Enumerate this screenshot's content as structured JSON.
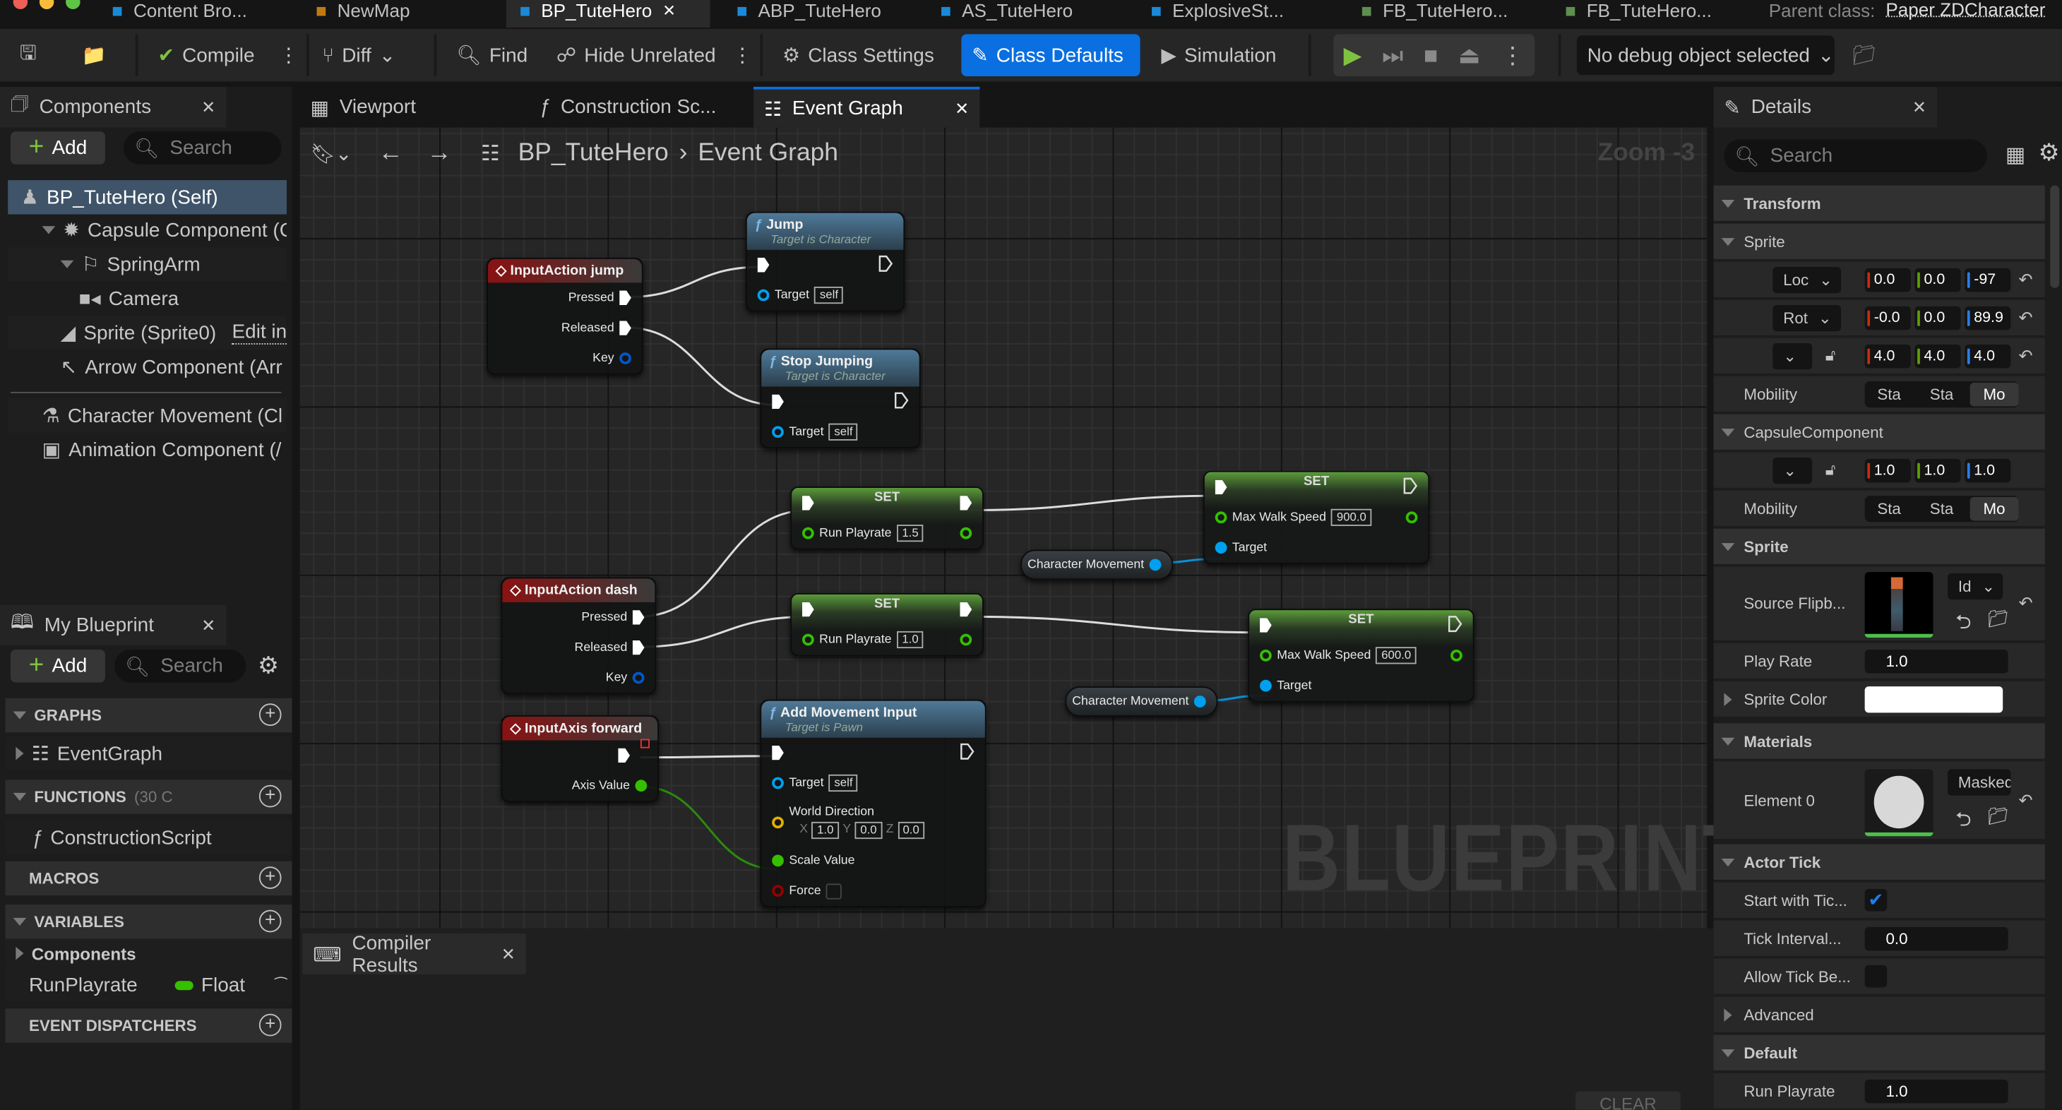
{
  "window_tabs": [
    {
      "label": "Content Bro...",
      "icon": "content-browser-icon"
    },
    {
      "label": "NewMap",
      "icon": "level-icon"
    },
    {
      "label": "BP_TuteHero",
      "icon": "blueprint-icon",
      "active": true,
      "closable": true
    },
    {
      "label": "ABP_TuteHero",
      "icon": "anim-blueprint-icon"
    },
    {
      "label": "AS_TuteHero",
      "icon": "anim-sequence-icon"
    },
    {
      "label": "ExplosiveSt...",
      "icon": "niagara-icon"
    },
    {
      "label": "FB_TuteHero...",
      "icon": "flipbook-icon"
    },
    {
      "label": "FB_TuteHero...",
      "icon": "flipbook-icon"
    }
  ],
  "parent_class": {
    "label": "Parent class:",
    "value": "Paper ZDCharacter"
  },
  "toolbar": {
    "compile": "Compile",
    "diff": "Diff",
    "find": "Find",
    "hide_unrelated": "Hide Unrelated",
    "class_settings": "Class Settings",
    "class_defaults": "Class Defaults",
    "simulation": "Simulation",
    "debug_object": "No debug object selected",
    "accent": "#0a6fe0",
    "play_color": "#7fc241"
  },
  "panel_tabs": {
    "components": "Components",
    "viewport": "Viewport",
    "construction": "Construction Sc...",
    "event_graph": "Event Graph",
    "details": "Details",
    "my_blueprint": "My Blueprint",
    "compiler_results": "Compiler Results"
  },
  "components": {
    "add": "Add",
    "search_placeholder": "Search",
    "items": [
      {
        "label": "BP_TuteHero (Self)",
        "icon": "actor-icon"
      },
      {
        "label": "Capsule Component (Co",
        "icon": "capsule-icon"
      },
      {
        "label": "SpringArm",
        "icon": "spring-arm-icon"
      },
      {
        "label": "Camera",
        "icon": "camera-icon"
      },
      {
        "label": "Sprite (Sprite0)",
        "icon": "sprite-icon",
        "link": "Edit in"
      },
      {
        "label": "Arrow Component (Arr",
        "icon": "arrow-icon"
      },
      {
        "label": "Character Movement (Cl",
        "icon": "character-movement-icon"
      },
      {
        "label": "Animation Component (/",
        "icon": "component-icon"
      }
    ]
  },
  "my_blueprint": {
    "add": "Add",
    "search_placeholder": "Search",
    "graphs": "GRAPHS",
    "event_graph": "EventGraph",
    "functions": "FUNCTIONS",
    "functions_count": "(30 C",
    "construction_script": "ConstructionScript",
    "macros": "MACROS",
    "variables": "VARIABLES",
    "components": "Components",
    "variable": {
      "name": "RunPlayrate",
      "type": "Float",
      "type_color": "#35c000"
    },
    "event_dispatchers": "EVENT DISPATCHERS"
  },
  "graph": {
    "breadcrumb": [
      "BP_TuteHero",
      "Event Graph"
    ],
    "zoom": "Zoom -3",
    "watermark": "BLUEPRINT",
    "nodes": [
      {
        "id": "ia_jump",
        "kind": "event",
        "title": "InputAction jump",
        "rows": [
          {
            "right": {
              "pin": "exec",
              "label": "Pressed"
            }
          },
          {
            "right": {
              "pin": "exec",
              "label": "Released"
            }
          },
          {
            "right": {
              "pin": "struct",
              "label": "Key"
            }
          }
        ]
      },
      {
        "id": "jump",
        "kind": "function",
        "title": "Jump",
        "subtitle": "Target is Character",
        "rows": [
          {
            "left": {
              "pin": "exec"
            },
            "right": {
              "pin": "execo"
            }
          },
          {
            "left": {
              "pin": "object",
              "label": "Target",
              "value": "self"
            }
          }
        ]
      },
      {
        "id": "stop",
        "kind": "function",
        "title": "Stop Jumping",
        "subtitle": "Target is Character",
        "rows": [
          {
            "left": {
              "pin": "exec"
            },
            "right": {
              "pin": "execo"
            }
          },
          {
            "left": {
              "pin": "object",
              "label": "Target",
              "value": "self"
            }
          }
        ]
      },
      {
        "id": "set1",
        "kind": "set",
        "title": "SET",
        "rows": [
          {
            "left": {
              "pin": "exec"
            },
            "right": {
              "pin": "exec"
            }
          },
          {
            "left": {
              "pin": "float",
              "label": "Run Playrate",
              "value": "1.5"
            },
            "right": {
              "pin": "float"
            }
          }
        ]
      },
      {
        "id": "cm1",
        "kind": "getter",
        "title": "Character Movement"
      },
      {
        "id": "set2",
        "kind": "set",
        "title": "SET",
        "rows": [
          {
            "left": {
              "pin": "exec"
            },
            "right": {
              "pin": "execo"
            }
          },
          {
            "left": {
              "pin": "float",
              "label": "Max Walk Speed",
              "value": "900.0"
            },
            "right": {
              "pin": "float"
            }
          },
          {
            "left": {
              "pin": "objectf",
              "label": "Target"
            }
          }
        ]
      },
      {
        "id": "ia_dash",
        "kind": "event",
        "title": "InputAction dash",
        "rows": [
          {
            "right": {
              "pin": "exec",
              "label": "Pressed"
            }
          },
          {
            "right": {
              "pin": "exec",
              "label": "Released"
            }
          },
          {
            "right": {
              "pin": "struct",
              "label": "Key"
            }
          }
        ]
      },
      {
        "id": "set3",
        "kind": "set",
        "title": "SET",
        "rows": [
          {
            "left": {
              "pin": "exec"
            },
            "right": {
              "pin": "exec"
            }
          },
          {
            "left": {
              "pin": "float",
              "label": "Run Playrate",
              "value": "1.0"
            },
            "right": {
              "pin": "float"
            }
          }
        ]
      },
      {
        "id": "set4",
        "kind": "set",
        "title": "SET",
        "rows": [
          {
            "left": {
              "pin": "exec"
            },
            "right": {
              "pin": "execo"
            }
          },
          {
            "left": {
              "pin": "float",
              "label": "Max Walk Speed",
              "value": "600.0"
            },
            "right": {
              "pin": "float"
            }
          },
          {
            "left": {
              "pin": "objectf",
              "label": "Target"
            }
          }
        ]
      },
      {
        "id": "cm2",
        "kind": "getter",
        "title": "Character Movement"
      },
      {
        "id": "ia_fwd",
        "kind": "axis",
        "title": "InputAxis forward",
        "rows": [
          {
            "right": {
              "pin": "exec"
            }
          },
          {
            "right": {
              "pin": "floatf",
              "label": "Axis Value"
            }
          }
        ]
      },
      {
        "id": "ami",
        "kind": "function",
        "title": "Add Movement Input",
        "subtitle": "Target is Pawn",
        "rows": [
          {
            "left": {
              "pin": "exec"
            },
            "right": {
              "pin": "execo"
            }
          },
          {
            "left": {
              "pin": "object",
              "label": "Target",
              "value": "self"
            }
          },
          {
            "left": {
              "pin": "vector",
              "label": "World Direction",
              "xyz": [
                "1.0",
                "0.0",
                "0.0"
              ]
            }
          },
          {
            "left": {
              "pin": "floatf",
              "label": "Scale Value"
            }
          },
          {
            "left": {
              "pin": "bool",
              "label": "Force",
              "checkbox": true
            }
          }
        ]
      }
    ],
    "pin_colors": {
      "exec": "#ffffff",
      "object": "#00a0f0",
      "float": "#35c000",
      "struct": "#0058c8",
      "vector": "#e0b000",
      "bool": "#950000"
    }
  },
  "compiler": {
    "clear": "CLEAR"
  },
  "details": {
    "search_placeholder": "Search",
    "transform": "Transform",
    "sprite": "Sprite",
    "loc": {
      "mode": "Loc",
      "x": "0.0",
      "y": "0.0",
      "z": "-97"
    },
    "rot": {
      "mode": "Rot",
      "x": "-0.0",
      "y": "0.0",
      "z": "89.9"
    },
    "scale": {
      "x": "4.0",
      "y": "4.0",
      "z": "4.0"
    },
    "mobility": "Mobility",
    "mobility_options": [
      "Sta",
      "Sta",
      "Mo"
    ],
    "capsule": "CapsuleComponent",
    "capsule_scale": {
      "x": "1.0",
      "y": "1.0",
      "z": "1.0"
    },
    "sprite_section": "Sprite",
    "source_flipbook": "Source Flipb...",
    "flipbook_asset": "Id",
    "play_rate": {
      "label": "Play Rate",
      "value": "1.0"
    },
    "sprite_color": {
      "label": "Sprite Color",
      "value": "#ffffff"
    },
    "materials": "Materials",
    "element0": {
      "label": "Element 0",
      "value": "MaskedU"
    },
    "actor_tick": "Actor Tick",
    "start_with_tick": {
      "label": "Start with Tic...",
      "checked": true
    },
    "tick_interval": {
      "label": "Tick Interval...",
      "value": "0.0"
    },
    "allow_tick": {
      "label": "Allow Tick Be...",
      "checked": false
    },
    "advanced": "Advanced",
    "default": "Default",
    "run_playrate": {
      "label": "Run Playrate",
      "value": "1.0"
    }
  }
}
